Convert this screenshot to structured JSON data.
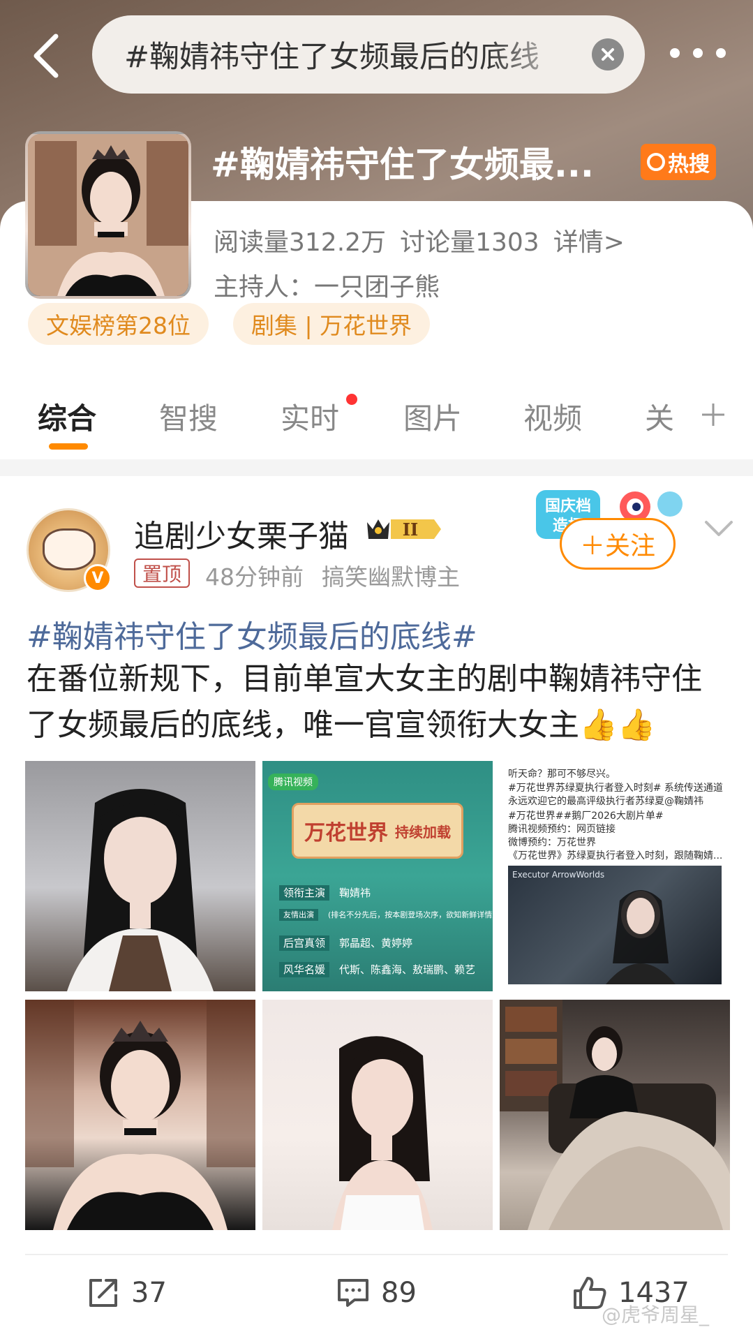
{
  "search": {
    "query": "#鞠婧祎守住了女频最后的底线"
  },
  "topic": {
    "title": "#鞠婧祎守住了女频最...",
    "hot_label": "热搜",
    "reads": "阅读量312.2万",
    "discussions": "讨论量1303",
    "details": "详情>",
    "host": "主持人：一只团子熊",
    "tags": [
      "文娱榜第28位",
      "剧集 | 万花世界"
    ]
  },
  "tabs": [
    "综合",
    "智搜",
    "实时",
    "图片",
    "视频",
    "关"
  ],
  "post": {
    "username": "追剧少女栗子猫",
    "level": "II",
    "pinned": "置顶",
    "time": "48分钟前",
    "verified_tag": "搞笑幽默博主",
    "follow": "＋关注",
    "promo": "国庆档造梗",
    "hashtag": "#鞠婧祎守住了女频最后的底线#",
    "body": "在番位新规下，目前单宣大女主的剧中鞠婧祎守住了女频最后的底线，唯一官宣领衔大女主👍👍",
    "img2": {
      "badge": "腾讯视频",
      "title": "万花世界",
      "subtitle": "持续加载",
      "rows": [
        {
          "k": "领衔主演",
          "v": "鞠婧祎"
        },
        {
          "k": "友情出演",
          "v": "(排名不分先后，按本剧登场次序，欲知新鲜详情观看剧)"
        },
        {
          "k": "后宫真领",
          "v": "郭晶超、黄婷婷"
        },
        {
          "k": "风华名媛",
          "v": "代斯、陈鑫海、敖瑞鹏、赖艺"
        }
      ]
    },
    "img3": {
      "lines": [
        "听天命？那可不够尽兴。",
        "#万花世界苏绿夏执行者登入时刻# 系统传送通道永远欢迎它的最高评级执行者苏绿夏@鞠婧祎",
        "#万花世界##鹅厂2026大剧片单#",
        "腾讯视频预约：网页链接",
        "微博预约：万花世界",
        "《万花世界》苏绿夏执行者登入时刻，跟随鞠婧..."
      ],
      "shot_caption": "Executor ArrowWorlds"
    }
  },
  "actions": {
    "repost": "37",
    "comment": "89",
    "like": "1437"
  },
  "watermark": "@虎爷周星_",
  "colors": {
    "accent": "#ff8a00",
    "hashtag": "#4e6a9a",
    "hot": "#ff7a1a"
  }
}
